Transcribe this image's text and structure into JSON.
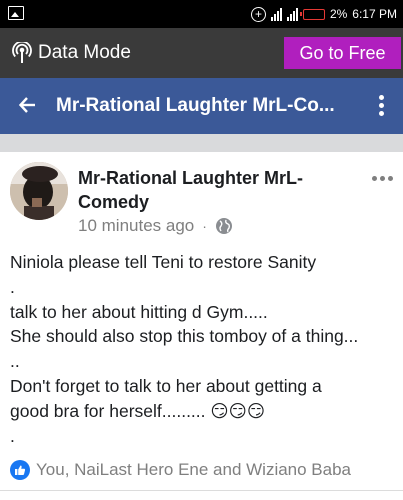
{
  "status_bar": {
    "battery_percent": "2%",
    "time": "6:17 PM"
  },
  "data_mode_bar": {
    "label": "Data Mode",
    "cta_label": "Go to Free",
    "cta_color": "#b01fbe"
  },
  "header": {
    "title": "Mr-Rational Laughter MrL-Co...",
    "color": "#3b5998"
  },
  "post": {
    "author": "Mr-Rational Laughter MrL-Comedy",
    "time_ago": "10 minutes ago",
    "separator": "·",
    "privacy_icon": "globe-icon",
    "body_lines": [
      "Niniola please tell Teni to restore Sanity",
      ".",
      " talk to her about hitting d Gym.....",
      "She should also stop this tomboy of a thing...",
      "..",
      "Don't forget to talk to her about getting a",
      "good bra for herself......... 😏😏😏",
      "."
    ],
    "reactions_text": "You, NaiLast Hero Ene and Wiziano Baba"
  }
}
